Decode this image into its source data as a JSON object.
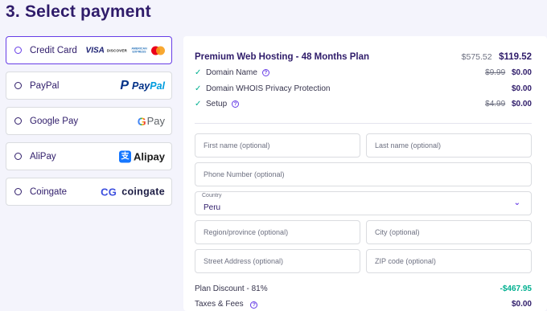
{
  "page": {
    "title": "3. Select payment"
  },
  "payment_methods": [
    {
      "label": "Credit Card",
      "selected": true,
      "logo": "card-brands-icon",
      "brands": {
        "visa": "VISA",
        "discover": "DISCOVER",
        "amex": "AMERICAN EXPRESS"
      }
    },
    {
      "label": "PayPal",
      "selected": false,
      "logo": "paypal-icon",
      "logo_text": {
        "pay": "Pay",
        "pal": "Pal"
      }
    },
    {
      "label": "Google Pay",
      "selected": false,
      "logo": "google-pay-icon",
      "logo_text": {
        "g": "G",
        "rest": "Pay"
      }
    },
    {
      "label": "AliPay",
      "selected": false,
      "logo": "alipay-icon",
      "logo_text": {
        "mark": "支",
        "text": "Alipay"
      }
    },
    {
      "label": "Coingate",
      "selected": false,
      "logo": "coingate-icon",
      "logo_text": {
        "mark": "CG",
        "text": "coingate"
      }
    }
  ],
  "summary": {
    "plan_name": "Premium Web Hosting - 48 Months Plan",
    "plan_old_price": "$575.52",
    "plan_new_price": "$119.52",
    "features": [
      {
        "label": "Domain Name",
        "help": true,
        "old_price": "$9.99",
        "price": "$0.00"
      },
      {
        "label": "Domain WHOIS Privacy Protection",
        "help": false,
        "old_price": "",
        "price": "$0.00"
      },
      {
        "label": "Setup",
        "help": true,
        "old_price": "$4.99",
        "price": "$0.00"
      }
    ],
    "form": {
      "first_name_placeholder": "First name (optional)",
      "last_name_placeholder": "Last name (optional)",
      "phone_placeholder": "Phone Number (optional)",
      "country_label": "Country",
      "country_value": "Peru",
      "region_placeholder": "Region/province (optional)",
      "city_placeholder": "City (optional)",
      "street_placeholder": "Street Address (optional)",
      "zip_placeholder": "ZIP code (optional)"
    },
    "plan_discount_label": "Plan Discount - 81%",
    "plan_discount_value": "-$467.95",
    "taxes_label": "Taxes & Fees",
    "taxes_value": "$0.00"
  },
  "colors": {
    "accent": "#673de6",
    "text": "#2f1c6a",
    "success": "#00b090",
    "background": "#f4f4fc"
  }
}
